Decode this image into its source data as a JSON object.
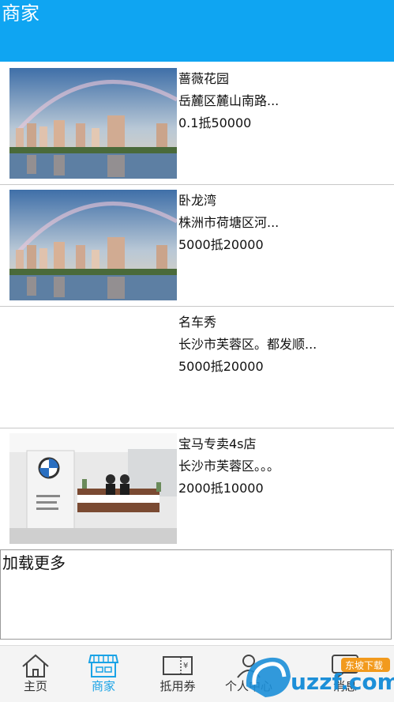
{
  "header": {
    "title": "商家"
  },
  "items": [
    {
      "name": "蔷薇花园",
      "address": "岳麓区麓山南路...",
      "offer": "0.1抵50000",
      "image": "city-skyline-photo"
    },
    {
      "name": "卧龙湾",
      "address": "株洲市荷塘区河...",
      "offer": "5000抵20000",
      "image": "city-skyline-photo"
    },
    {
      "name": "名车秀",
      "address": "长沙市芙蓉区。都发顺...",
      "offer": "5000抵20000",
      "image": "none"
    },
    {
      "name": "宝马专卖4s店",
      "address": "长沙市芙蓉区。。。",
      "offer": "2000抵10000",
      "image": "car-dealership-photo"
    }
  ],
  "load_more": {
    "label": "加载更多"
  },
  "tabbar": {
    "tabs": [
      {
        "label": "主页",
        "icon": "home-icon",
        "active": false
      },
      {
        "label": "商家",
        "icon": "store-icon",
        "active": true
      },
      {
        "label": "抵用券",
        "icon": "voucher-icon",
        "active": false
      },
      {
        "label": "个人中心",
        "icon": "person-icon",
        "active": false
      },
      {
        "label": "消息",
        "icon": "message-icon",
        "active": false
      }
    ]
  },
  "watermark": {
    "text": "uzzf.com",
    "badge": "东坡下载"
  },
  "colors": {
    "header": "#0fa5f2",
    "active_tab": "#1aa3e6"
  }
}
